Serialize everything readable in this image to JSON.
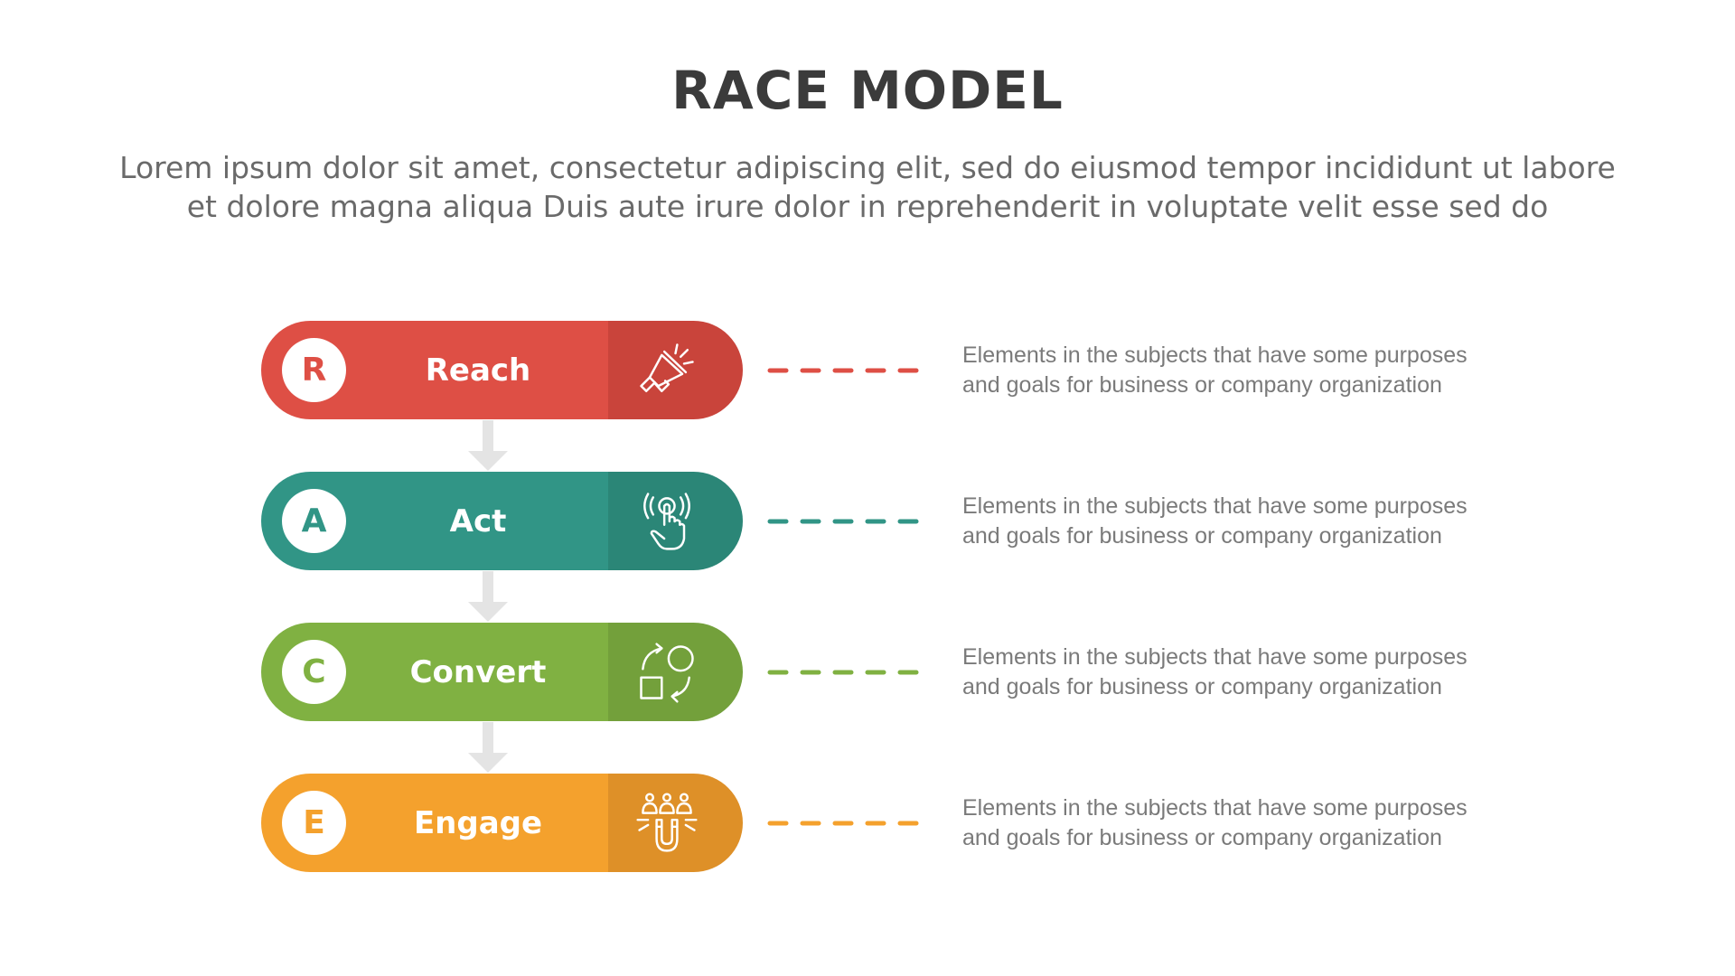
{
  "header": {
    "title": "RACE MODEL",
    "subtitle_lines": [
      "Lorem ipsum dolor sit amet, consectetur adipiscing elit, sed do eiusmod tempor incididunt ut labore",
      "et dolore magna aliqua Duis aute irure dolor in reprehenderit in voluptate velit esse sed do"
    ]
  },
  "colors": {
    "connector_arrow": "#e4e4e4",
    "description_text": "#7a7a7a"
  },
  "steps": [
    {
      "letter": "R",
      "label": "Reach",
      "icon": "megaphone-icon",
      "color_main": "#de4f45",
      "color_dark": "#c9443b",
      "description_lines": [
        "Elements in the subjects that have  some purposes",
        "and goals for business or company organization"
      ]
    },
    {
      "letter": "A",
      "label": "Act",
      "icon": "tap-hand-icon",
      "color_main": "#319586",
      "color_dark": "#2b8677",
      "description_lines": [
        "Elements in the subjects that have  some purposes",
        "and goals for business or company organization"
      ]
    },
    {
      "letter": "C",
      "label": "Convert",
      "icon": "convert-shapes-icon",
      "color_main": "#80b142",
      "color_dark": "#73a03b",
      "description_lines": [
        "Elements in the subjects that have  some purposes",
        "and goals for business or company organization"
      ]
    },
    {
      "letter": "E",
      "label": "Engage",
      "icon": "audience-magnet-icon",
      "color_main": "#f4a12d",
      "color_dark": "#de9028",
      "description_lines": [
        "Elements in the subjects that have  some purposes",
        "and goals for business or company organization"
      ]
    }
  ]
}
